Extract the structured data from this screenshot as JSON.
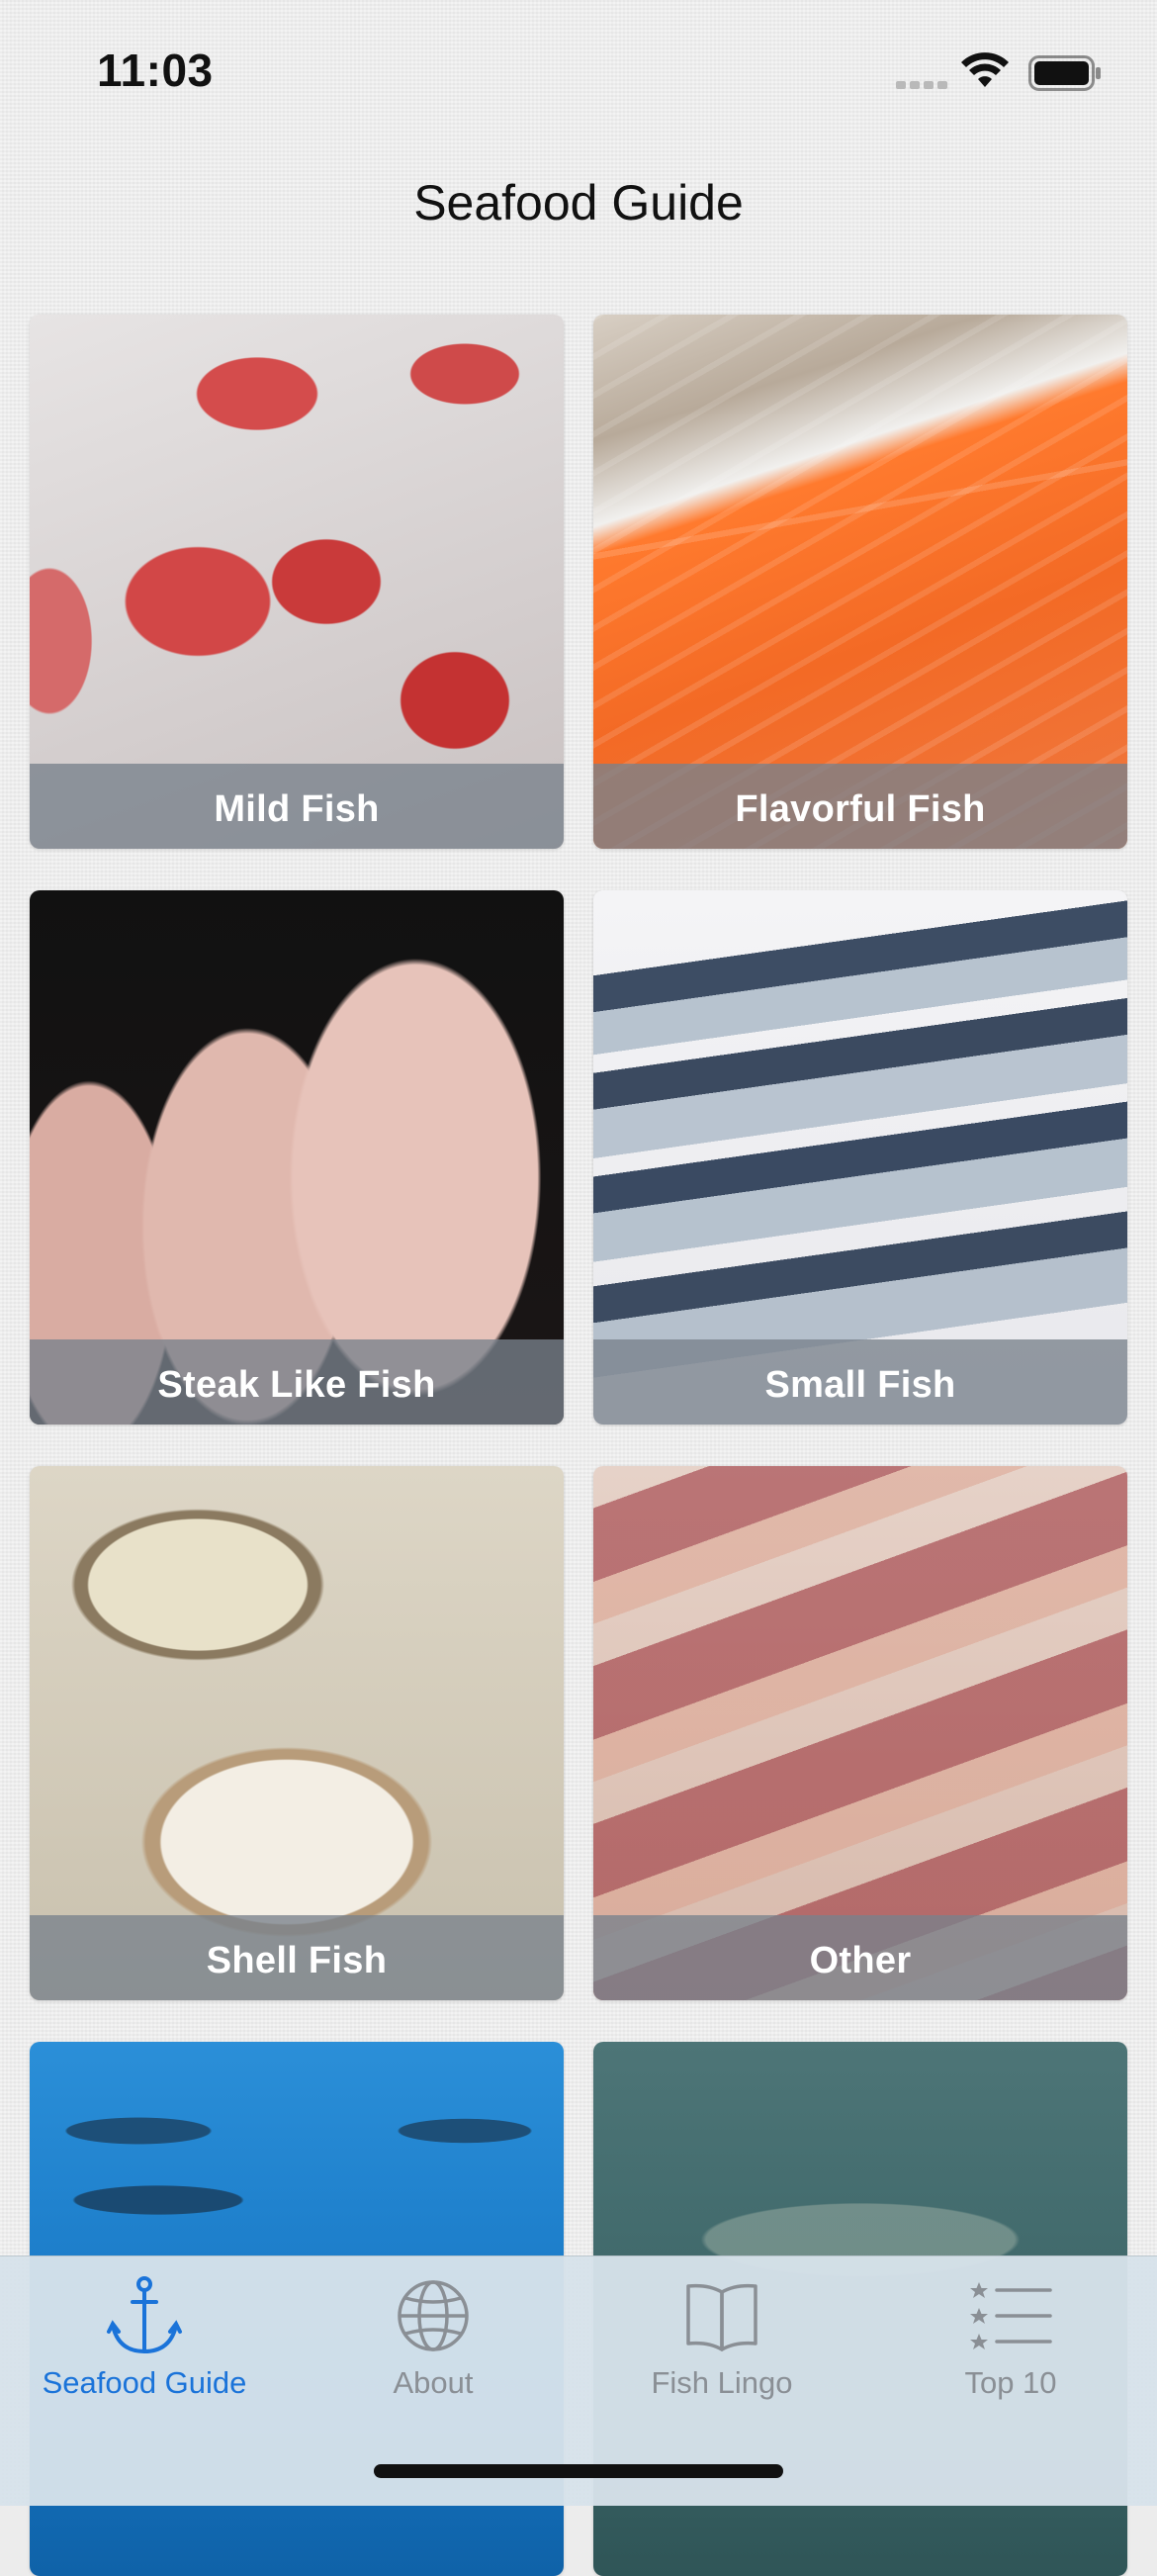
{
  "status_bar": {
    "time": "11:03"
  },
  "nav": {
    "title": "Seafood Guide"
  },
  "tiles": [
    {
      "label": "Mild Fish"
    },
    {
      "label": "Flavorful Fish"
    },
    {
      "label": "Steak Like Fish"
    },
    {
      "label": "Small Fish"
    },
    {
      "label": "Shell Fish"
    },
    {
      "label": "Other"
    },
    {
      "label": ""
    },
    {
      "label": ""
    }
  ],
  "tab_bar": {
    "items": [
      {
        "label": "Seafood Guide",
        "icon": "anchor-icon",
        "active": true
      },
      {
        "label": "About",
        "icon": "globe-icon",
        "active": false
      },
      {
        "label": "Fish Lingo",
        "icon": "book-icon",
        "active": false
      },
      {
        "label": "Top 10",
        "icon": "list-star-icon",
        "active": false
      }
    ]
  },
  "colors": {
    "accent": "#1a73d9",
    "inactive": "#8a8f95"
  }
}
